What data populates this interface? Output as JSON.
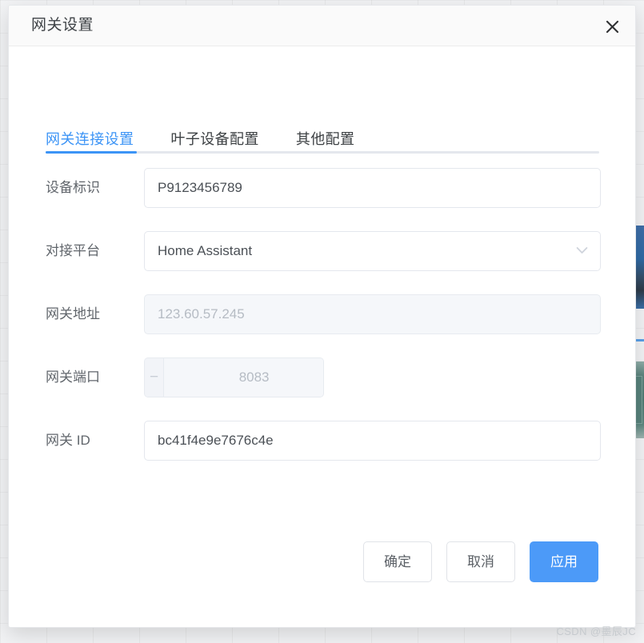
{
  "modal": {
    "title": "网关设置",
    "close_icon": "close-icon"
  },
  "tabs": [
    {
      "label": "网关连接设置",
      "active": true
    },
    {
      "label": "叶子设备配置",
      "active": false
    },
    {
      "label": "其他配置",
      "active": false
    }
  ],
  "form": {
    "fields": [
      {
        "label": "设备标识",
        "value": "P9123456789",
        "type": "text",
        "disabled": false,
        "name": "device-id"
      },
      {
        "label": "对接平台",
        "value": "Home Assistant",
        "type": "select",
        "disabled": false,
        "name": "platform",
        "chevron_icon": "chevron-down-icon"
      },
      {
        "label": "网关地址",
        "value": "123.60.57.245",
        "type": "text",
        "disabled": true,
        "name": "gateway-address"
      },
      {
        "label": "网关端口",
        "value": "8083",
        "type": "number",
        "disabled": true,
        "name": "gateway-port",
        "decrement_label": "−",
        "increment_label": "+"
      },
      {
        "label": "网关 ID",
        "value": "bc41f4e9e7676c4e",
        "type": "text",
        "disabled": false,
        "name": "gateway-id"
      }
    ]
  },
  "footer": {
    "confirm_label": "确定",
    "cancel_label": "取消",
    "apply_label": "应用"
  },
  "watermark": "CSDN @墨辰JC",
  "colors": {
    "accent": "#3c94f6",
    "primary_button": "#4c9af8",
    "label_text": "#61666c",
    "value_text": "#4b5056",
    "disabled_text": "#b6bcc4",
    "header_bg": "#fafafa",
    "tab_track": "#e4e7ed"
  }
}
